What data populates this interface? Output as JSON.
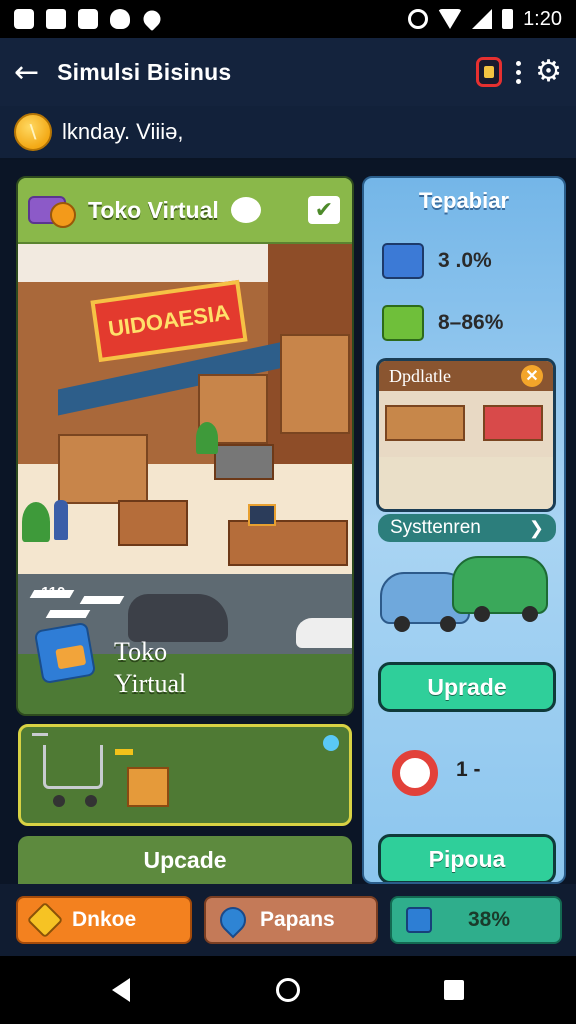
{
  "status_bar": {
    "time": "1:20"
  },
  "app_bar": {
    "back_icon": "arrow-left-icon",
    "title": "Simulsi Bisinus"
  },
  "sub_bar": {
    "icon": "coin-icon",
    "text": "lknday. Viiiə,"
  },
  "store_card": {
    "title": "Toko Virtual",
    "sign_text": "UIDOAESIA",
    "street_label": "‹ 110",
    "footer_label_line1": "Toko",
    "footer_label_line2": "Yirtual"
  },
  "left_upgrade": {
    "label": "Upcade"
  },
  "right_panel": {
    "title": "Tepabiar",
    "stats": [
      {
        "icon": "shop-stat-icon",
        "value": "3 .0%"
      },
      {
        "icon": "cash-stat-icon",
        "value": "8–86%"
      }
    ],
    "update_box": {
      "title": "Dpdlatle",
      "close_icon": "close-icon"
    },
    "system_button": {
      "label": "Systtenren",
      "icon": "chevron-right-icon"
    },
    "upgrade_button": {
      "label": "Uprade"
    },
    "timer": {
      "icon": "timer-icon",
      "value": "1 -"
    },
    "bottom_button": {
      "label": "Pipoua"
    }
  },
  "action_bar": {
    "buttons": [
      {
        "label": "Dnkoe",
        "icon": "diamond-icon",
        "color": "#f3811f"
      },
      {
        "label": "Papans",
        "icon": "location-pin-icon",
        "color": "#c47a58"
      },
      {
        "label": "38%",
        "icon": "box-icon",
        "color": "#2fae8c"
      }
    ]
  },
  "colors": {
    "background": "#0b1526",
    "store_green": "#4d7a35",
    "panel_blue": "#74b6e8",
    "button_teal": "#2fcf9a"
  }
}
